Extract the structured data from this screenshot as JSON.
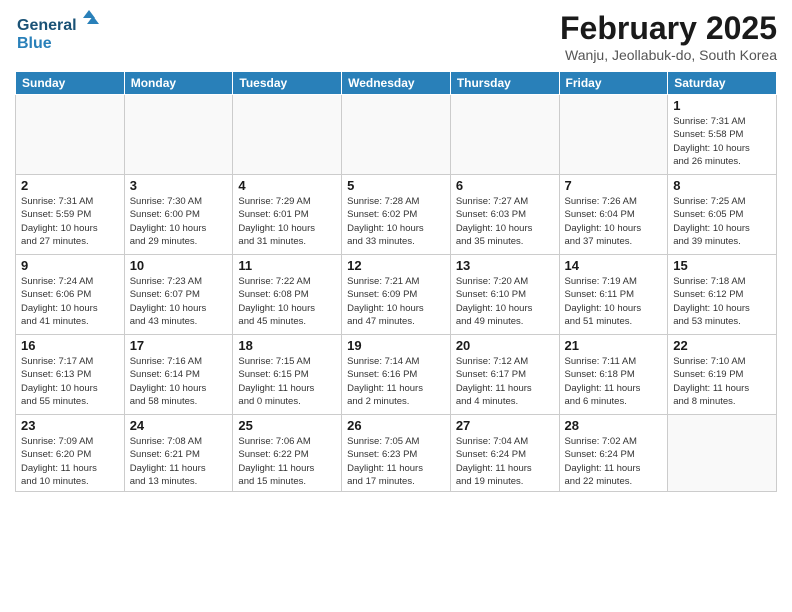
{
  "header": {
    "logo_line1": "General",
    "logo_line2": "Blue",
    "main_title": "February 2025",
    "subtitle": "Wanju, Jeollabuk-do, South Korea"
  },
  "weekdays": [
    "Sunday",
    "Monday",
    "Tuesday",
    "Wednesday",
    "Thursday",
    "Friday",
    "Saturday"
  ],
  "weeks": [
    [
      {
        "day": "",
        "info": ""
      },
      {
        "day": "",
        "info": ""
      },
      {
        "day": "",
        "info": ""
      },
      {
        "day": "",
        "info": ""
      },
      {
        "day": "",
        "info": ""
      },
      {
        "day": "",
        "info": ""
      },
      {
        "day": "1",
        "info": "Sunrise: 7:31 AM\nSunset: 5:58 PM\nDaylight: 10 hours\nand 26 minutes."
      }
    ],
    [
      {
        "day": "2",
        "info": "Sunrise: 7:31 AM\nSunset: 5:59 PM\nDaylight: 10 hours\nand 27 minutes."
      },
      {
        "day": "3",
        "info": "Sunrise: 7:30 AM\nSunset: 6:00 PM\nDaylight: 10 hours\nand 29 minutes."
      },
      {
        "day": "4",
        "info": "Sunrise: 7:29 AM\nSunset: 6:01 PM\nDaylight: 10 hours\nand 31 minutes."
      },
      {
        "day": "5",
        "info": "Sunrise: 7:28 AM\nSunset: 6:02 PM\nDaylight: 10 hours\nand 33 minutes."
      },
      {
        "day": "6",
        "info": "Sunrise: 7:27 AM\nSunset: 6:03 PM\nDaylight: 10 hours\nand 35 minutes."
      },
      {
        "day": "7",
        "info": "Sunrise: 7:26 AM\nSunset: 6:04 PM\nDaylight: 10 hours\nand 37 minutes."
      },
      {
        "day": "8",
        "info": "Sunrise: 7:25 AM\nSunset: 6:05 PM\nDaylight: 10 hours\nand 39 minutes."
      }
    ],
    [
      {
        "day": "9",
        "info": "Sunrise: 7:24 AM\nSunset: 6:06 PM\nDaylight: 10 hours\nand 41 minutes."
      },
      {
        "day": "10",
        "info": "Sunrise: 7:23 AM\nSunset: 6:07 PM\nDaylight: 10 hours\nand 43 minutes."
      },
      {
        "day": "11",
        "info": "Sunrise: 7:22 AM\nSunset: 6:08 PM\nDaylight: 10 hours\nand 45 minutes."
      },
      {
        "day": "12",
        "info": "Sunrise: 7:21 AM\nSunset: 6:09 PM\nDaylight: 10 hours\nand 47 minutes."
      },
      {
        "day": "13",
        "info": "Sunrise: 7:20 AM\nSunset: 6:10 PM\nDaylight: 10 hours\nand 49 minutes."
      },
      {
        "day": "14",
        "info": "Sunrise: 7:19 AM\nSunset: 6:11 PM\nDaylight: 10 hours\nand 51 minutes."
      },
      {
        "day": "15",
        "info": "Sunrise: 7:18 AM\nSunset: 6:12 PM\nDaylight: 10 hours\nand 53 minutes."
      }
    ],
    [
      {
        "day": "16",
        "info": "Sunrise: 7:17 AM\nSunset: 6:13 PM\nDaylight: 10 hours\nand 55 minutes."
      },
      {
        "day": "17",
        "info": "Sunrise: 7:16 AM\nSunset: 6:14 PM\nDaylight: 10 hours\nand 58 minutes."
      },
      {
        "day": "18",
        "info": "Sunrise: 7:15 AM\nSunset: 6:15 PM\nDaylight: 11 hours\nand 0 minutes."
      },
      {
        "day": "19",
        "info": "Sunrise: 7:14 AM\nSunset: 6:16 PM\nDaylight: 11 hours\nand 2 minutes."
      },
      {
        "day": "20",
        "info": "Sunrise: 7:12 AM\nSunset: 6:17 PM\nDaylight: 11 hours\nand 4 minutes."
      },
      {
        "day": "21",
        "info": "Sunrise: 7:11 AM\nSunset: 6:18 PM\nDaylight: 11 hours\nand 6 minutes."
      },
      {
        "day": "22",
        "info": "Sunrise: 7:10 AM\nSunset: 6:19 PM\nDaylight: 11 hours\nand 8 minutes."
      }
    ],
    [
      {
        "day": "23",
        "info": "Sunrise: 7:09 AM\nSunset: 6:20 PM\nDaylight: 11 hours\nand 10 minutes."
      },
      {
        "day": "24",
        "info": "Sunrise: 7:08 AM\nSunset: 6:21 PM\nDaylight: 11 hours\nand 13 minutes."
      },
      {
        "day": "25",
        "info": "Sunrise: 7:06 AM\nSunset: 6:22 PM\nDaylight: 11 hours\nand 15 minutes."
      },
      {
        "day": "26",
        "info": "Sunrise: 7:05 AM\nSunset: 6:23 PM\nDaylight: 11 hours\nand 17 minutes."
      },
      {
        "day": "27",
        "info": "Sunrise: 7:04 AM\nSunset: 6:24 PM\nDaylight: 11 hours\nand 19 minutes."
      },
      {
        "day": "28",
        "info": "Sunrise: 7:02 AM\nSunset: 6:24 PM\nDaylight: 11 hours\nand 22 minutes."
      },
      {
        "day": "",
        "info": ""
      }
    ]
  ]
}
